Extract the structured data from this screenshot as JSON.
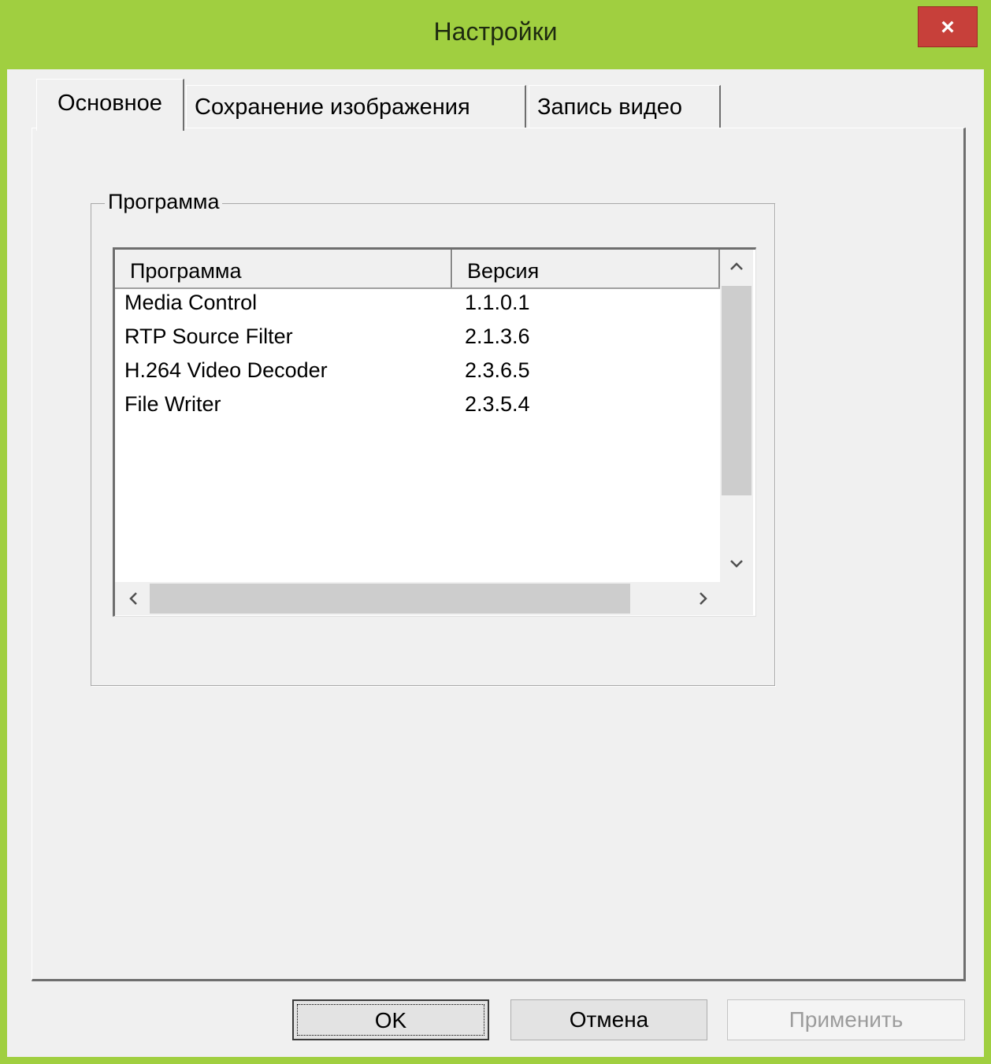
{
  "window": {
    "title": "Настройки",
    "close_glyph": "×"
  },
  "tabs": [
    {
      "label": "Основное",
      "active": true
    },
    {
      "label": "Сохранение изображения",
      "active": false
    },
    {
      "label": "Запись видео",
      "active": false
    }
  ],
  "group": {
    "label": "Программа",
    "list": {
      "columns": [
        "Программа",
        "Версия"
      ],
      "rows": [
        {
          "program": "Media Control",
          "version": "1.1.0.1"
        },
        {
          "program": "RTP Source Filter",
          "version": "2.1.3.6"
        },
        {
          "program": "H.264 Video Decoder",
          "version": "2.3.6.5"
        },
        {
          "program": "File Writer",
          "version": "2.3.5.4"
        }
      ],
      "scroll_icons": {
        "up": "chevron-up-icon",
        "down": "chevron-down-icon",
        "left": "chevron-left-icon",
        "right": "chevron-right-icon"
      }
    }
  },
  "buttons": {
    "ok": "OK",
    "cancel": "Отмена",
    "apply": "Применить"
  },
  "colors": {
    "frame": "#a0cf40",
    "close": "#c7403a",
    "face": "#f0f0f0"
  }
}
